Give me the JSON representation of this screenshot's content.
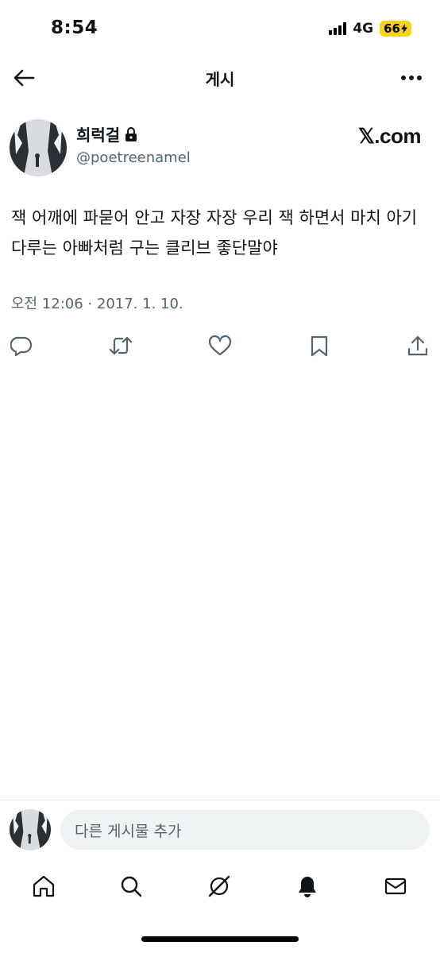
{
  "status_bar": {
    "time": "8:54",
    "network": "4G",
    "battery": "66"
  },
  "header": {
    "title": "게시"
  },
  "post": {
    "display_name": "희럭걸",
    "username": "@poetreenamel",
    "source": "𝕏.com",
    "text": "잭 어깨에 파묻어 안고 자장 자장 우리 잭 하면서 마치 아기다루는 아빠처럼 구는 클리브 좋단말야",
    "timestamp": "오전 12:06 · 2017. 1. 10."
  },
  "composer": {
    "placeholder": "다른 게시물 추가"
  },
  "colors": {
    "text_primary": "#0f1419",
    "text_secondary": "#536471",
    "battery_badge": "#f7d21a",
    "input_bg": "#eff3f4"
  },
  "icons": {
    "header": [
      "back-arrow-icon",
      "more-dots-icon"
    ],
    "actions": [
      "reply-icon",
      "retweet-icon",
      "like-icon",
      "bookmark-icon",
      "share-icon"
    ],
    "nav": [
      "home-icon",
      "search-icon",
      "grok-icon",
      "notifications-icon",
      "messages-icon"
    ]
  }
}
